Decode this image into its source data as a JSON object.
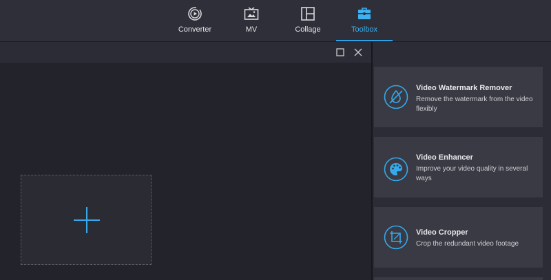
{
  "nav": {
    "tabs": [
      {
        "label": "Converter",
        "icon": "converter-icon"
      },
      {
        "label": "MV",
        "icon": "mv-icon"
      },
      {
        "label": "Collage",
        "icon": "collage-icon"
      },
      {
        "label": "Toolbox",
        "icon": "toolbox-icon",
        "active": true
      }
    ],
    "accent_color": "#3fb1ef"
  },
  "window_controls": {
    "maximize_icon": "maximize-icon",
    "close_icon": "close-icon"
  },
  "dropzone": {
    "icon": "plus-icon"
  },
  "tools": [
    {
      "title": "Video Watermark Remover",
      "description": "Remove the watermark from the video flexibly",
      "icon": "watermark-remover-icon"
    },
    {
      "title": "Video Enhancer",
      "description": "Improve your video quality in several ways",
      "icon": "palette-icon"
    },
    {
      "title": "Video Cropper",
      "description": "Crop the redundant video footage",
      "icon": "crop-icon"
    }
  ]
}
